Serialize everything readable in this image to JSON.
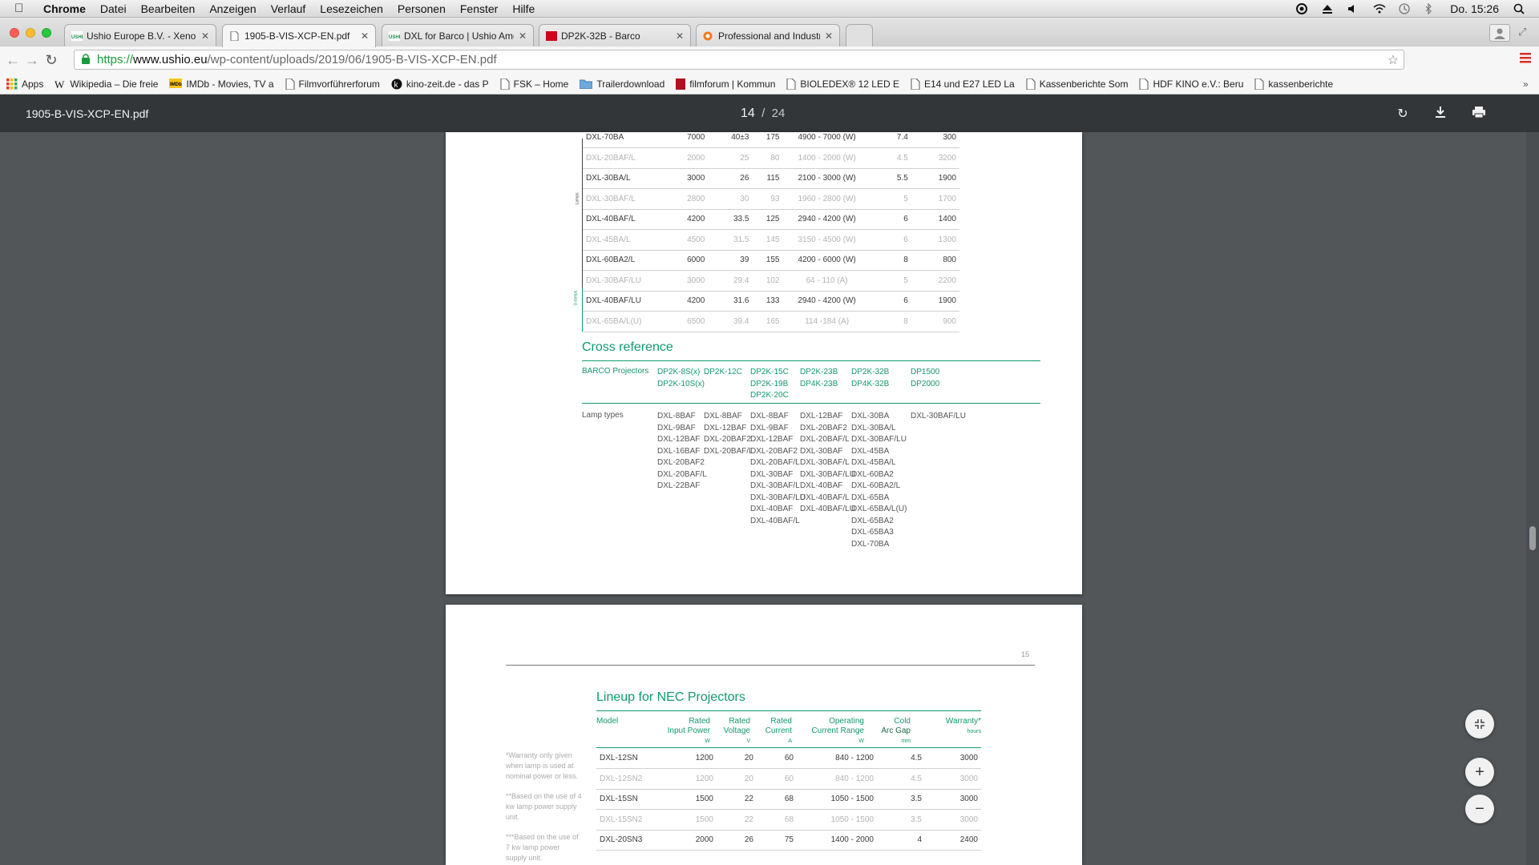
{
  "menubar": {
    "app": "Chrome",
    "items": [
      "Datei",
      "Bearbeiten",
      "Anzeigen",
      "Verlauf",
      "Lesezeichen",
      "Personen",
      "Fenster",
      "Hilfe"
    ],
    "clock": "Do. 15:26"
  },
  "tabs": [
    {
      "label": "Ushio Europe B.V. - Xenon",
      "favicon": "ushio-icon"
    },
    {
      "label": "1905-B-VIS-XCP-EN.pdf",
      "favicon": "document-icon",
      "active": true
    },
    {
      "label": "DXL for Barco | Ushio Ame",
      "favicon": "ushio-icon"
    },
    {
      "label": "DP2K-32B - Barco",
      "favicon": "barco-icon"
    },
    {
      "label": "Professional and Industrial",
      "favicon": "orange-circle-icon"
    }
  ],
  "address": {
    "scheme": "https://",
    "host": "www.ushio.eu",
    "path": "/wp-content/uploads/2019/06/1905-B-VIS-XCP-EN.pdf"
  },
  "bookmarks": [
    {
      "label": "Apps",
      "icon": "apps-grid-icon"
    },
    {
      "label": "Wikipedia – Die freie",
      "icon": "wikipedia-icon"
    },
    {
      "label": "IMDb - Movies, TV a",
      "icon": "imdb-icon"
    },
    {
      "label": "Filmvorführerforum",
      "icon": "page-icon"
    },
    {
      "label": "kino-zeit.de - das P",
      "icon": "kinozeit-icon"
    },
    {
      "label": "FSK – Home",
      "icon": "page-icon"
    },
    {
      "label": "Trailerdownload",
      "icon": "folder-icon"
    },
    {
      "label": "filmforum | Kommun",
      "icon": "filmforum-icon"
    },
    {
      "label": "BIOLEDEX® 12 LED E",
      "icon": "page-icon"
    },
    {
      "label": "E14 und E27 LED La",
      "icon": "page-icon"
    },
    {
      "label": "Kassenberichte Som",
      "icon": "page-icon"
    },
    {
      "label": "HDF KINO e.V.: Beru",
      "icon": "page-icon"
    },
    {
      "label": "kassenberichte",
      "icon": "page-icon"
    }
  ],
  "pdf": {
    "filename": "1905-B-VIS-XCP-EN.pdf",
    "page_current": "14",
    "page_sep": "/",
    "page_total": "24"
  },
  "page14": {
    "section_lamps": "Lamps",
    "section_ulamps": "U-lamps",
    "rows": [
      {
        "model": "DXL-70BA",
        "w": "7000",
        "v": "40±3",
        "a": "175",
        "range": "4900 - 7000 (W)",
        "gap": "7.4",
        "hours": "300",
        "dim": false
      },
      {
        "model": "DXL-20BAF/L",
        "w": "2000",
        "v": "25",
        "a": "80",
        "range": "1400 - 2000 (W)",
        "gap": "4.5",
        "hours": "3200",
        "dim": true
      },
      {
        "model": "DXL-30BA/L",
        "w": "3000",
        "v": "26",
        "a": "115",
        "range": "2100 - 3000 (W)",
        "gap": "5.5",
        "hours": "1900",
        "dim": false
      },
      {
        "model": "DXL-30BAF/L",
        "w": "2800",
        "v": "30",
        "a": "93",
        "range": "1960 - 2800 (W)",
        "gap": "5",
        "hours": "1700",
        "dim": true
      },
      {
        "model": "DXL-40BAF/L",
        "w": "4200",
        "v": "33.5",
        "a": "125",
        "range": "2940 - 4200 (W)",
        "gap": "6",
        "hours": "1400",
        "dim": false
      },
      {
        "model": "DXL-45BA/L",
        "w": "4500",
        "v": "31.5",
        "a": "145",
        "range": "3150 - 4500 (W)",
        "gap": "6",
        "hours": "1300",
        "dim": true
      },
      {
        "model": "DXL-60BA2/L",
        "w": "6000",
        "v": "39",
        "a": "155",
        "range": "4200 - 6000 (W)",
        "gap": "8",
        "hours": "800",
        "dim": false
      },
      {
        "model": "DXL-30BAF/LU",
        "w": "3000",
        "v": "29.4",
        "a": "102",
        "range": "64 - 110 (A)",
        "gap": "5",
        "hours": "2200",
        "dim": true
      },
      {
        "model": "DXL-40BAF/LU",
        "w": "4200",
        "v": "31.6",
        "a": "133",
        "range": "2940 - 4200 (W)",
        "gap": "6",
        "hours": "1900",
        "dim": false
      },
      {
        "model": "DXL-65BA/L(U)",
        "w": "6500",
        "v": "39.4",
        "a": "165",
        "range": "114 -184 (A)",
        "gap": "8",
        "hours": "900",
        "dim": true
      }
    ],
    "cross_title": "Cross reference",
    "barco_label": "BARCO Projectors",
    "lamp_label": "Lamp types",
    "projector_cols": [
      [
        "DP2K-8S(x)",
        "DP2K-10S(x)"
      ],
      [
        "DP2K-12C"
      ],
      [
        "DP2K-15C",
        "DP2K-19B",
        "DP2K-20C"
      ],
      [
        "DP2K-23B",
        "DP4K-23B"
      ],
      [
        "DP2K-32B",
        "DP4K-32B"
      ],
      [
        "DP1500",
        "DP2000"
      ]
    ],
    "lamp_cols": [
      [
        "DXL-8BAF",
        "DXL-9BAF",
        "DXL-12BAF",
        "DXL-16BAF",
        "DXL-20BAF2",
        "DXL-20BAF/L",
        "DXL-22BAF"
      ],
      [
        "DXL-8BAF",
        "DXL-12BAF",
        "DXL-20BAF2",
        "DXL-20BAF/L"
      ],
      [
        "DXL-8BAF",
        "DXL-9BAF",
        "DXL-12BAF",
        "DXL-20BAF2",
        "DXL-20BAF/L",
        "DXL-30BAF",
        "DXL-30BAF/L",
        "DXL-30BAF/LU",
        "DXL-40BAF",
        "DXL-40BAF/L"
      ],
      [
        "DXL-12BAF",
        "DXL-20BAF2",
        "DXL-20BAF/L",
        "DXL-30BAF",
        "DXL-30BAF/L",
        "DXL-30BAF/LU",
        "DXL-40BAF",
        "DXL-40BAF/L",
        "DXL-40BAF/LU"
      ],
      [
        "DXL-30BA",
        "DXL-30BA/L",
        "DXL-30BAF/LU",
        "DXL-45BA",
        "DXL-45BA/L",
        "DXL-60BA2",
        "DXL-60BA2/L",
        "DXL-65BA",
        "DXL-65BA/L(U)",
        "DXL-65BA2",
        "DXL-65BA3",
        "DXL-70BA"
      ],
      [
        "DXL-30BAF/LU"
      ]
    ]
  },
  "page15": {
    "page_number": "15",
    "title": "Lineup for NEC Projectors",
    "headers": [
      {
        "l1": "Model",
        "l2": "",
        "unit": ""
      },
      {
        "l1": "Rated",
        "l2": "Input Power",
        "unit": "W"
      },
      {
        "l1": "Rated",
        "l2": "Voltage",
        "unit": "V"
      },
      {
        "l1": "Rated",
        "l2": "Current",
        "unit": "A"
      },
      {
        "l1": "Operating",
        "l2": "Current Range",
        "unit": "W"
      },
      {
        "l1": "Cold",
        "l2": "Arc Gap",
        "unit": "mm"
      },
      {
        "l1": "Warranty*",
        "l2": "",
        "unit": "hours"
      }
    ],
    "notes": [
      "*Warranty only given when lamp is used at nominal power or less.",
      "**Based on the use of 4 kw lamp power supply unit.",
      "***Based on the use of 7 kw lamp power supply unit."
    ],
    "rows": [
      {
        "model": "DXL-12SN",
        "w": "1200",
        "v": "20",
        "a": "60",
        "range": "840 - 1200",
        "gap": "4.5",
        "hours": "3000",
        "dim": false
      },
      {
        "model": "DXL-12SN2",
        "w": "1200",
        "v": "20",
        "a": "60",
        "range": "840 - 1200",
        "gap": "4.5",
        "hours": "3000",
        "dim": true
      },
      {
        "model": "DXL-15SN",
        "w": "1500",
        "v": "22",
        "a": "68",
        "range": "1050 - 1500",
        "gap": "3.5",
        "hours": "3000",
        "dim": false
      },
      {
        "model": "DXL-15SN2",
        "w": "1500",
        "v": "22",
        "a": "68",
        "range": "1050 - 1500",
        "gap": "3.5",
        "hours": "3000",
        "dim": true
      },
      {
        "model": "DXL-20SN3",
        "w": "2000",
        "v": "26",
        "a": "75",
        "range": "1400 - 2000",
        "gap": "4",
        "hours": "2400",
        "dim": false
      }
    ]
  },
  "colors": {
    "accent_green": "#129a6c",
    "pdf_toolbar": "#323639",
    "viewer_bg": "#525659"
  }
}
